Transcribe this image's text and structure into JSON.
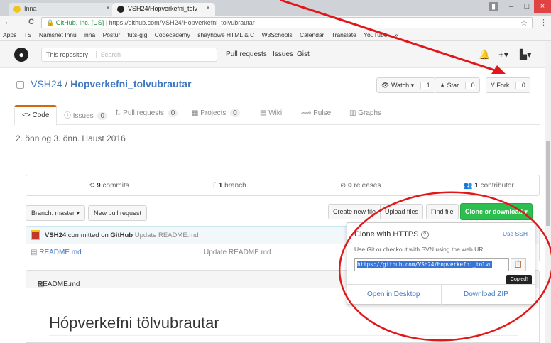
{
  "browser": {
    "tabs": [
      {
        "label": "Inna",
        "close": "×"
      },
      {
        "label": "VSH24/Hopverkefni_tolv",
        "close": "×"
      }
    ],
    "window_buttons": [
      "–",
      "□",
      "×"
    ],
    "nav": {
      "back": "←",
      "forward": "→",
      "reload": "C"
    },
    "address": {
      "secure_label": "GitHub, Inc. [US]",
      "url": "https://github.com/VSH24/Hopverkefni_tolvubrautar"
    },
    "star": "☆",
    "menu": "⋮",
    "bookmarks": [
      "Apps",
      "TS",
      "Námsnet Innu",
      "inna",
      "Póstur",
      "tuts-gjg",
      "Codecademy",
      "shayhowe HTML & C",
      "W3Schools",
      "Calendar",
      "Translate",
      "YouTube",
      "»"
    ]
  },
  "header": {
    "search_scope": "This repository",
    "search_placeholder": "Search",
    "nav": [
      "Pull requests",
      "Issues",
      "Gist"
    ]
  },
  "repo": {
    "owner": "VSH24",
    "separator": "/",
    "name": "Hopverkefni_tolvubrautar",
    "watch_label": "Watch ▾",
    "watch_count": "1",
    "star_label": "Star",
    "star_count": "0",
    "fork_label": "Fork",
    "fork_count": "0",
    "tabs": [
      {
        "label": "Code",
        "count": ""
      },
      {
        "label": "Issues",
        "count": "0"
      },
      {
        "label": "Pull requests",
        "count": "0"
      },
      {
        "label": "Projects",
        "count": "0"
      },
      {
        "label": "Wiki",
        "count": ""
      },
      {
        "label": "Pulse",
        "count": ""
      },
      {
        "label": "Graphs",
        "count": ""
      }
    ],
    "description": "2. önn og 3. önn. Haust 2016",
    "stats": {
      "commits_num": "9",
      "commits_label": "commits",
      "branch_num": "1",
      "branch_label": "branch",
      "releases_num": "0",
      "releases_label": "releases",
      "contributor_num": "1",
      "contributor_label": "contributor"
    },
    "branch_button": "Branch: master ▾",
    "new_pr_button": "New pull request",
    "create_file": "Create new file",
    "upload_files": "Upload files",
    "find_file": "Find file",
    "clone_button": "Clone or download ▾",
    "commit": {
      "user": "VSH24",
      "via": "committed on",
      "platform": "GitHub",
      "message": "Update README.md"
    },
    "files": [
      {
        "name": "README.md",
        "message": "Update README.md"
      }
    ],
    "readme_label": "README.md",
    "readme_title": "Hópverkefni tölvubrautar"
  },
  "clone_panel": {
    "title": "Clone with HTTPS",
    "help_icon": "?",
    "use_ssh": "Use SSH",
    "help_text": "Use Git or checkout with SVN using the web URL.",
    "url": "https://github.com/VSH24/Hopverkefni_tolvu",
    "tooltip": "Copied!",
    "open_desktop": "Open in Desktop",
    "download_zip": "Download ZIP"
  },
  "colors": {
    "accent": "#4078c0",
    "clone_green": "#2cbe4e",
    "annotation_red": "#e0181b"
  }
}
